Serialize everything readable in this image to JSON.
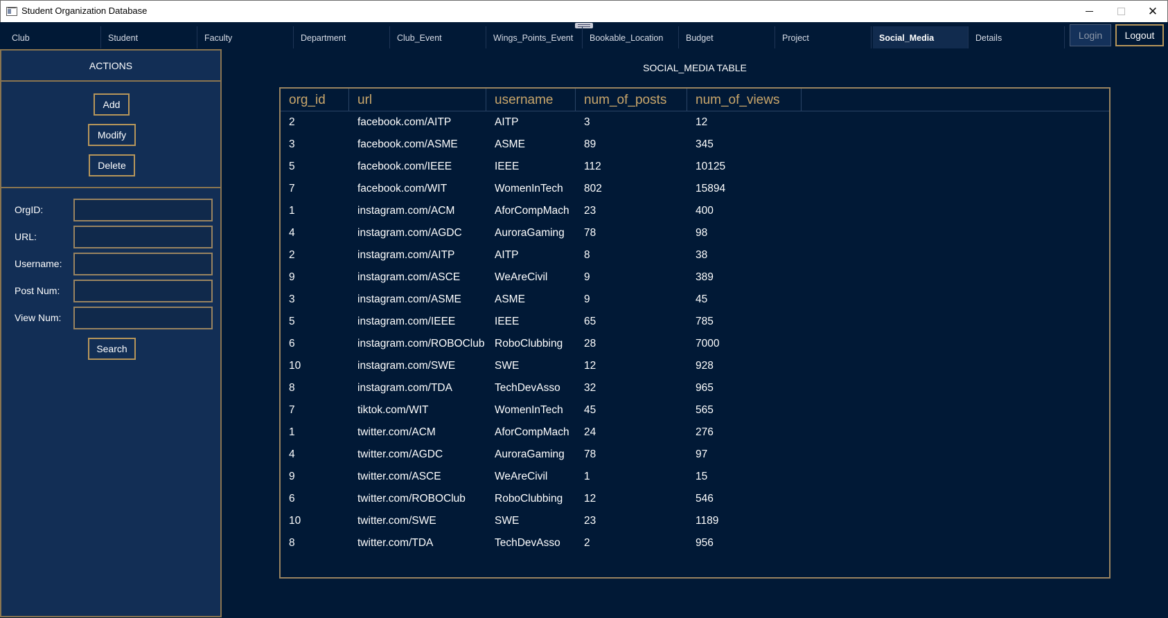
{
  "window": {
    "title": "Student Organization Database"
  },
  "tabs": [
    {
      "label": "Club"
    },
    {
      "label": "Student"
    },
    {
      "label": "Faculty"
    },
    {
      "label": "Department"
    },
    {
      "label": "Club_Event"
    },
    {
      "label": "Wings_Points_Event"
    },
    {
      "label": "Bookable_Location"
    },
    {
      "label": "Budget"
    },
    {
      "label": "Project"
    },
    {
      "label": "Social_Media"
    },
    {
      "label": "Details"
    }
  ],
  "active_tab": "Social_Media",
  "auth": {
    "login_label": "Login",
    "logout_label": "Logout"
  },
  "sidebar": {
    "header": "ACTIONS",
    "add_label": "Add",
    "modify_label": "Modify",
    "delete_label": "Delete",
    "fields": [
      {
        "label": "OrgID:",
        "value": ""
      },
      {
        "label": "URL:",
        "value": ""
      },
      {
        "label": "Username:",
        "value": ""
      },
      {
        "label": "Post Num:",
        "value": ""
      },
      {
        "label": "View Num:",
        "value": ""
      }
    ],
    "search_label": "Search"
  },
  "main": {
    "title": "SOCIAL_MEDIA TABLE",
    "columns": [
      "org_id",
      "url",
      "username",
      "num_of_posts",
      "num_of_views"
    ],
    "rows": [
      [
        "2",
        "facebook.com/AITP",
        "AITP",
        "3",
        "12"
      ],
      [
        "3",
        "facebook.com/ASME",
        "ASME",
        "89",
        "345"
      ],
      [
        "5",
        "facebook.com/IEEE",
        "IEEE",
        "112",
        "10125"
      ],
      [
        "7",
        "facebook.com/WIT",
        "WomenInTech",
        "802",
        "15894"
      ],
      [
        "1",
        "instagram.com/ACM",
        "AforCompMach",
        "23",
        "400"
      ],
      [
        "4",
        "instagram.com/AGDC",
        "AuroraGaming",
        "78",
        "98"
      ],
      [
        "2",
        "instagram.com/AITP",
        "AITP",
        "8",
        "38"
      ],
      [
        "9",
        "instagram.com/ASCE",
        "WeAreCivil",
        "9",
        "389"
      ],
      [
        "3",
        "instagram.com/ASME",
        "ASME",
        "9",
        "45"
      ],
      [
        "5",
        "instagram.com/IEEE",
        "IEEE",
        "65",
        "785"
      ],
      [
        "6",
        "instagram.com/ROBOClub",
        "RoboClubbing",
        "28",
        "7000"
      ],
      [
        "10",
        "instagram.com/SWE",
        "SWE",
        "12",
        "928"
      ],
      [
        "8",
        "instagram.com/TDA",
        "TechDevAsso",
        "32",
        "965"
      ],
      [
        "7",
        "tiktok.com/WIT",
        "WomenInTech",
        "45",
        "565"
      ],
      [
        "1",
        "twitter.com/ACM",
        "AforCompMach",
        "24",
        "276"
      ],
      [
        "4",
        "twitter.com/AGDC",
        "AuroraGaming",
        "78",
        "97"
      ],
      [
        "9",
        "twitter.com/ASCE",
        "WeAreCivil",
        "1",
        "15"
      ],
      [
        "6",
        "twitter.com/ROBOClub",
        "RoboClubbing",
        "12",
        "546"
      ],
      [
        "10",
        "twitter.com/SWE",
        "SWE",
        "23",
        "1189"
      ],
      [
        "8",
        "twitter.com/TDA",
        "TechDevAsso",
        "2",
        "956"
      ]
    ]
  },
  "colors": {
    "background": "#011936",
    "panel": "#122e55",
    "accent_gold": "#c9a66b",
    "border_gold": "#9a8460"
  }
}
